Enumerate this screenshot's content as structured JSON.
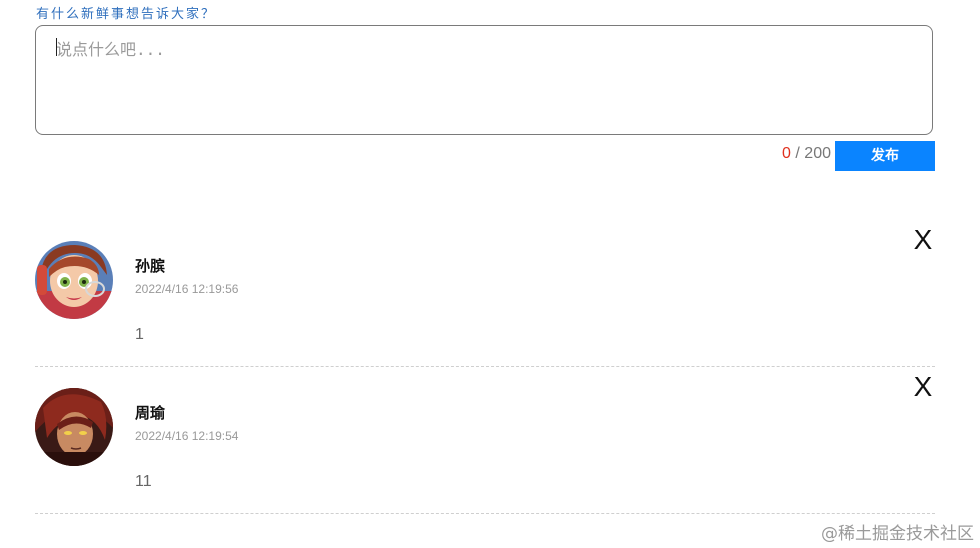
{
  "compose": {
    "prompt": "有什么新鲜事想告诉大家？",
    "placeholder": "说点什么吧...",
    "value": "",
    "count_current": "0",
    "count_separator": " / ",
    "count_max": "200",
    "publish_label": "发布"
  },
  "comments": [
    {
      "name": "孙膑",
      "time": "2022/4/16 12:19:56",
      "text": "1",
      "delete_label": "X",
      "avatar_icon": "sun-bin-hero-avatar"
    },
    {
      "name": "周瑜",
      "time": "2022/4/16 12:19:54",
      "text": "11",
      "delete_label": "X",
      "avatar_icon": "zhou-yu-hero-avatar"
    }
  ],
  "watermark": "@稀土掘金技术社区",
  "colors": {
    "accent": "#0a84ff",
    "count_highlight": "#e0301e",
    "prompt": "#2f6fbd"
  }
}
